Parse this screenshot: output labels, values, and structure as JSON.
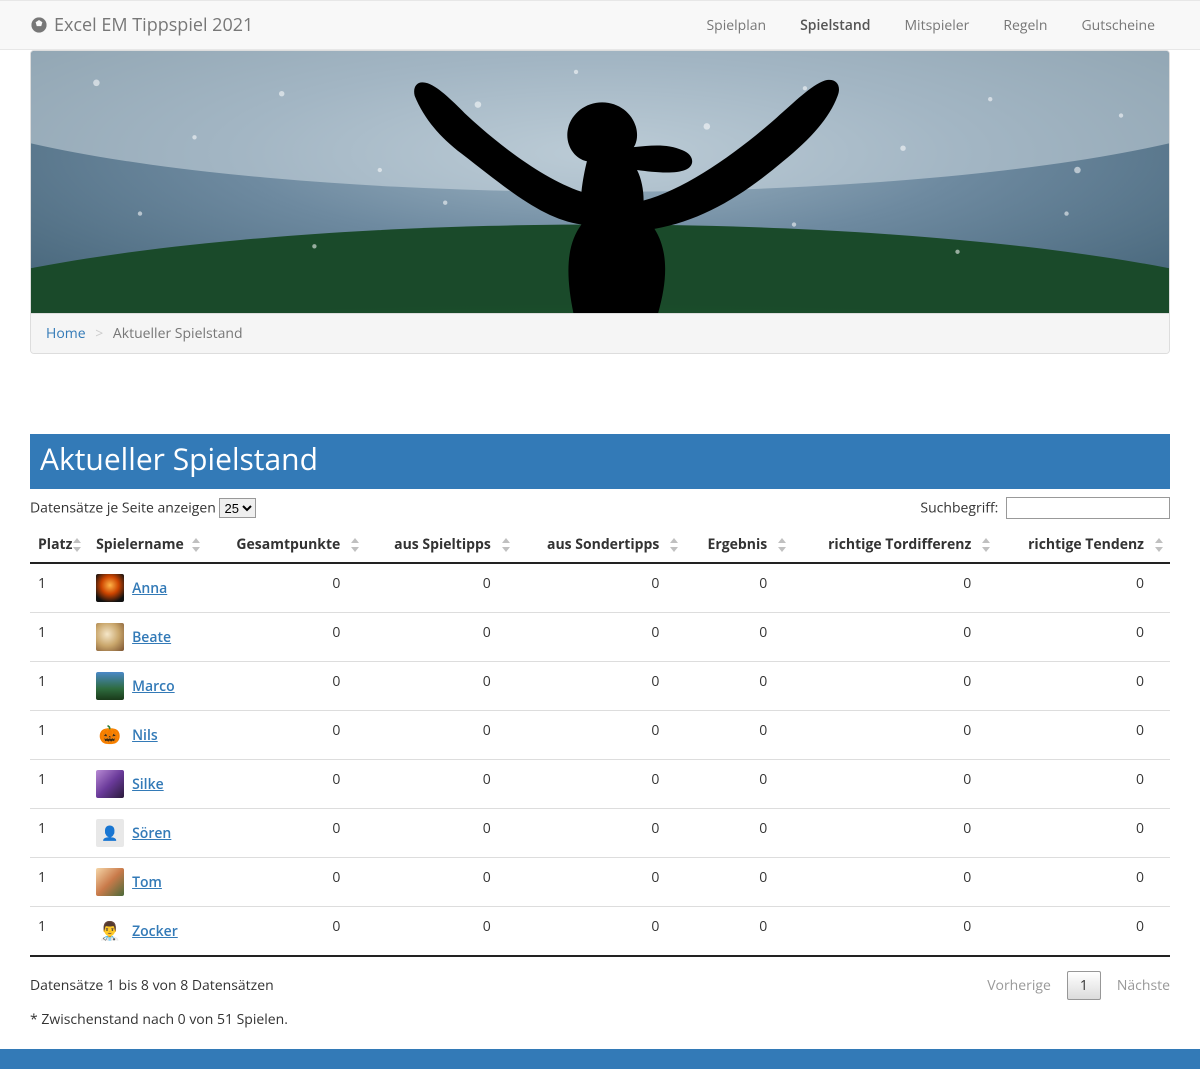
{
  "brand": "Excel EM Tippspiel 2021",
  "nav": [
    "Spielplan",
    "Spielstand",
    "Mitspieler",
    "Regeln",
    "Gutscheine"
  ],
  "nav_active": 1,
  "breadcrumb": {
    "home": "Home",
    "current": "Aktueller Spielstand"
  },
  "page_title": "Aktueller Spielstand",
  "length_label_pre": "Datensätze je Seite anzeigen",
  "length_value": "25",
  "search_label": "Suchbegriff:",
  "columns": [
    "Platz",
    "Spielername",
    "Gesamtpunkte",
    "aus Spieltipps",
    "aus Sondertipps",
    "Ergebnis",
    "richtige Tordifferenz",
    "richtige Tendenz"
  ],
  "rows": [
    {
      "rank": "1",
      "name": "Anna",
      "avatar": "av-anna",
      "emoji": "",
      "totals": [
        "0",
        "0",
        "0",
        "0",
        "0",
        "0"
      ]
    },
    {
      "rank": "1",
      "name": "Beate",
      "avatar": "av-beate",
      "emoji": "",
      "totals": [
        "0",
        "0",
        "0",
        "0",
        "0",
        "0"
      ]
    },
    {
      "rank": "1",
      "name": "Marco",
      "avatar": "av-marco",
      "emoji": "",
      "totals": [
        "0",
        "0",
        "0",
        "0",
        "0",
        "0"
      ]
    },
    {
      "rank": "1",
      "name": "Nils",
      "avatar": "av-nils",
      "emoji": "🎃",
      "totals": [
        "0",
        "0",
        "0",
        "0",
        "0",
        "0"
      ]
    },
    {
      "rank": "1",
      "name": "Silke",
      "avatar": "av-silke",
      "emoji": "",
      "totals": [
        "0",
        "0",
        "0",
        "0",
        "0",
        "0"
      ]
    },
    {
      "rank": "1",
      "name": "Sören",
      "avatar": "av-soren",
      "emoji": "👤",
      "totals": [
        "0",
        "0",
        "0",
        "0",
        "0",
        "0"
      ]
    },
    {
      "rank": "1",
      "name": "Tom",
      "avatar": "av-tom",
      "emoji": "",
      "totals": [
        "0",
        "0",
        "0",
        "0",
        "0",
        "0"
      ]
    },
    {
      "rank": "1",
      "name": "Zocker",
      "avatar": "av-zocker",
      "emoji": "👨‍⚕️",
      "totals": [
        "0",
        "0",
        "0",
        "0",
        "0",
        "0"
      ]
    }
  ],
  "info": "Datensätze 1 bis 8 von 8 Datensätzen",
  "pager": {
    "prev": "Vorherige",
    "page": "1",
    "next": "Nächste"
  },
  "footnote": "* Zwischenstand nach 0 von 51 Spielen."
}
